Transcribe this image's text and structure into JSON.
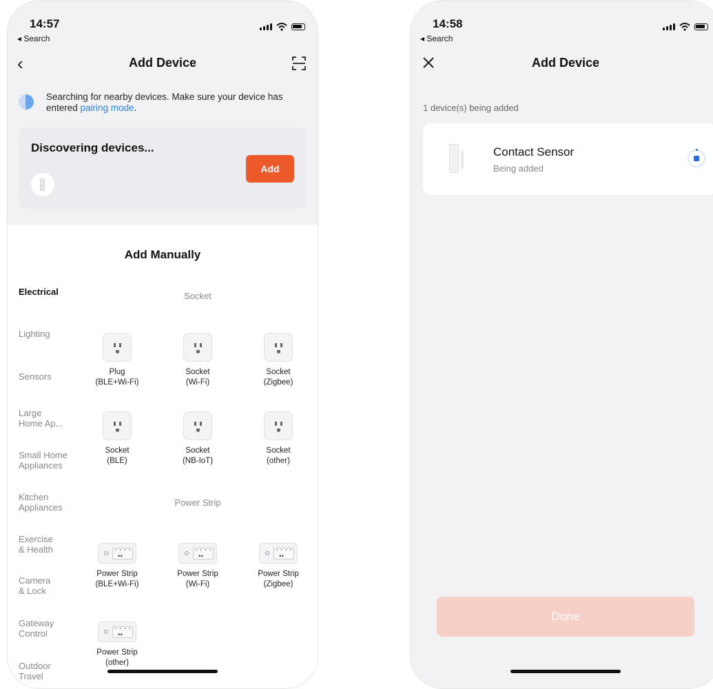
{
  "left": {
    "status": {
      "time": "14:57",
      "back": "◂ Search"
    },
    "nav": {
      "title": "Add Device"
    },
    "hint": {
      "text": "Searching for nearby devices. Make sure your device has entered ",
      "link": "pairing mode",
      "suffix": "."
    },
    "discover": {
      "title": "Discovering devices...",
      "add_label": "Add"
    },
    "manual": {
      "title": "Add Manually",
      "categories": [
        {
          "line1": "Electrical",
          "line2": ""
        },
        {
          "line1": "Lighting",
          "line2": ""
        },
        {
          "line1": "Sensors",
          "line2": ""
        },
        {
          "line1": "Large",
          "line2": "Home Ap..."
        },
        {
          "line1": "Small Home",
          "line2": "Appliances"
        },
        {
          "line1": "Kitchen",
          "line2": "Appliances"
        },
        {
          "line1": "Exercise",
          "line2": "& Health"
        },
        {
          "line1": "Camera",
          "line2": "& Lock"
        },
        {
          "line1": "Gateway",
          "line2": "Control"
        },
        {
          "line1": "Outdoor",
          "line2": "Travel"
        }
      ],
      "sections": {
        "socket": "Socket",
        "power_strip": "Power Strip"
      },
      "sockets": [
        {
          "l1": "Plug",
          "l2": "(BLE+Wi-Fi)"
        },
        {
          "l1": "Socket",
          "l2": "(Wi-Fi)"
        },
        {
          "l1": "Socket",
          "l2": "(Zigbee)"
        },
        {
          "l1": "Socket",
          "l2": "(BLE)"
        },
        {
          "l1": "Socket",
          "l2": "(NB-IoT)"
        },
        {
          "l1": "Socket",
          "l2": "(other)"
        }
      ],
      "strips": [
        {
          "l1": "Power Strip",
          "l2": "(BLE+Wi-Fi)"
        },
        {
          "l1": "Power Strip",
          "l2": "(Wi-Fi)"
        },
        {
          "l1": "Power Strip",
          "l2": "(Zigbee)"
        },
        {
          "l1": "Power Strip",
          "l2": "(other)"
        }
      ]
    }
  },
  "right": {
    "status": {
      "time": "14:58",
      "back": "◂ Search"
    },
    "nav": {
      "title": "Add Device"
    },
    "added_count": "1 device(s) being added",
    "device": {
      "name": "Contact Sensor",
      "status": "Being added"
    },
    "done_label": "Done"
  },
  "colors": {
    "accent": "#ec5a2c",
    "link": "#2a7de1",
    "done_disabled": "#f6d0c6"
  }
}
